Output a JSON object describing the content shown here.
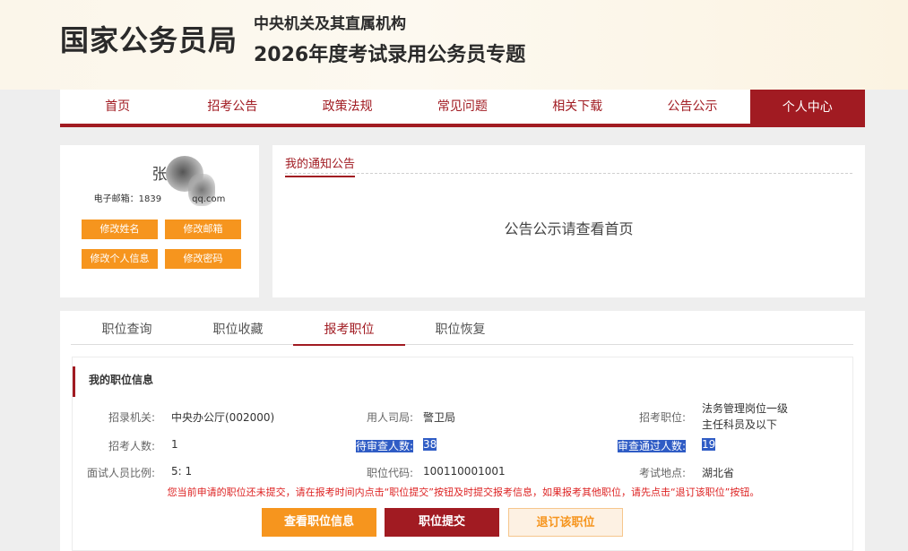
{
  "header": {
    "site_name": "国家公务员局",
    "subtitle_1": "中央机关及其直属机构",
    "subtitle_2": "2026年度考试录用公务员专题"
  },
  "nav": [
    "首页",
    "招考公告",
    "政策法规",
    "常见问题",
    "相关下载",
    "公告公示",
    "个人中心"
  ],
  "profile": {
    "name": "张",
    "email_label": "电子邮箱：1839",
    "email_suffix": "qq.com",
    "buttons": [
      "修改姓名",
      "修改邮箱",
      "修改个人信息",
      "修改密码"
    ]
  },
  "notice": {
    "title": "我的通知公告",
    "text": "公告公示请查看首页"
  },
  "tabs": [
    "职位查询",
    "职位收藏",
    "报考职位",
    "职位恢复"
  ],
  "position": {
    "title": "我的职位信息",
    "org_label": "招录机关:",
    "org_value": "中央办公厅(002000)",
    "bureau_label": "用人司局:",
    "bureau_value": "警卫局",
    "post_label": "招考职位:",
    "post_value_line1": "法务管理岗位一级",
    "post_value_line2": "主任科员及以下",
    "count_label": "招考人数:",
    "count_value": "1",
    "pending_label": "待审查人数:",
    "pending_value": "38",
    "passed_label": "审查通过人数:",
    "passed_value": "19",
    "ratio_label": "面试人员比例:",
    "ratio_value": "5: 1",
    "code_label": "职位代码:",
    "code_value": "100110001001",
    "place_label": "考试地点:",
    "place_value": "湖北省",
    "warning": "您当前申请的职位还未提交，请在报考时间内点击“职位提交”按钮及时提交报考信息，如果报考其他职位，请先点击“退订该职位”按钮。",
    "buttons": {
      "view": "查看职位信息",
      "submit": "职位提交",
      "unsubscribe": "退订该职位"
    }
  },
  "colors": {
    "brand_red": "#a11b22",
    "orange": "#f6951e",
    "highlight_blue": "#2f5cc5"
  }
}
